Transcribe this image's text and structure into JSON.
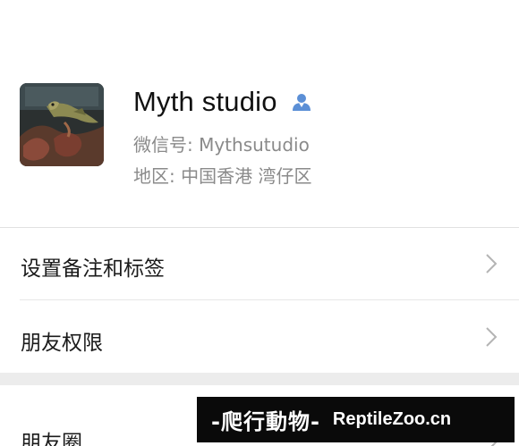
{
  "profile": {
    "name": "Myth studio",
    "wechat_id": "微信号: Mythsutudio",
    "region": "地区: 中国香港  湾仔区",
    "avatar_icon": "lizard-photo-avatar",
    "contact_icon": "person-contact-icon",
    "accent_color": "#5b8fd6"
  },
  "menu": {
    "items": [
      {
        "label": "设置备注和标签"
      },
      {
        "label": "朋友权限"
      },
      {
        "label": "朋友圈"
      }
    ]
  },
  "watermark": {
    "main": "-爬行動物-",
    "site": "ReptileZoo.cn"
  }
}
